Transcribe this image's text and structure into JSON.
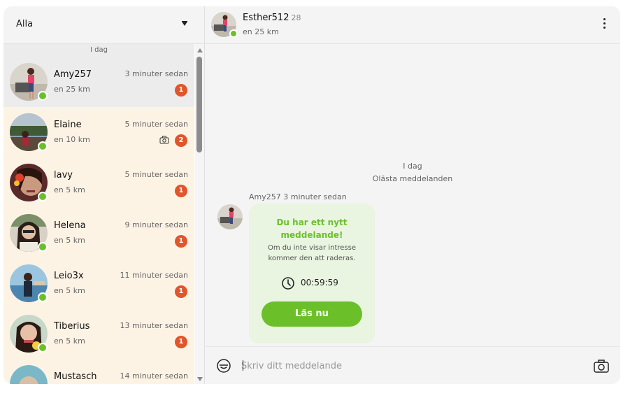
{
  "filter": {
    "label": "Alla"
  },
  "list": {
    "day_label": "I dag",
    "items": [
      {
        "name": "Amy257",
        "distance": "en 25 km",
        "time": "3 minuter sedan",
        "unread": "1",
        "photo": false
      },
      {
        "name": "Elaine",
        "distance": "en 10 km",
        "time": "5 minuter sedan",
        "unread": "2",
        "photo": true
      },
      {
        "name": "lavy",
        "distance": "en 5 km",
        "time": "5 minuter sedan",
        "unread": "1",
        "photo": false
      },
      {
        "name": "Helena",
        "distance": "en 5 km",
        "time": "9 minuter sedan",
        "unread": "1",
        "photo": false
      },
      {
        "name": "Leio3x",
        "distance": "en 5 km",
        "time": "11 minuter sedan",
        "unread": "1",
        "photo": false
      },
      {
        "name": "Tiberius",
        "distance": "en 5 km",
        "time": "13 minuter sedan",
        "unread": "1",
        "photo": false
      },
      {
        "name": "Mustasch",
        "distance": "",
        "time": "14 minuter sedan",
        "unread": "",
        "photo": false
      }
    ]
  },
  "chat": {
    "header": {
      "name": "Esther512",
      "age": "28",
      "distance": "en 25 km"
    },
    "day_label": "I dag",
    "unread_label": "Olästa meddelanden",
    "message": {
      "sender": "Amy257",
      "time": "3 minuter sedan",
      "title": "Du har ett nytt meddelande!",
      "description": "Om du inte visar intresse kommer den att raderas.",
      "timer": "00:59:59",
      "button_label": "Läs nu"
    },
    "composer": {
      "placeholder": "Skriv ditt meddelande"
    }
  },
  "colors": {
    "accent": "#6bc02a",
    "badge": "#e0552c",
    "list_bg": "#fdf3e5",
    "active_bg": "#ececec"
  },
  "icons": [
    "chevron-down-icon",
    "camera-icon",
    "kebab-menu-icon",
    "clock-icon",
    "emoji-icon"
  ]
}
